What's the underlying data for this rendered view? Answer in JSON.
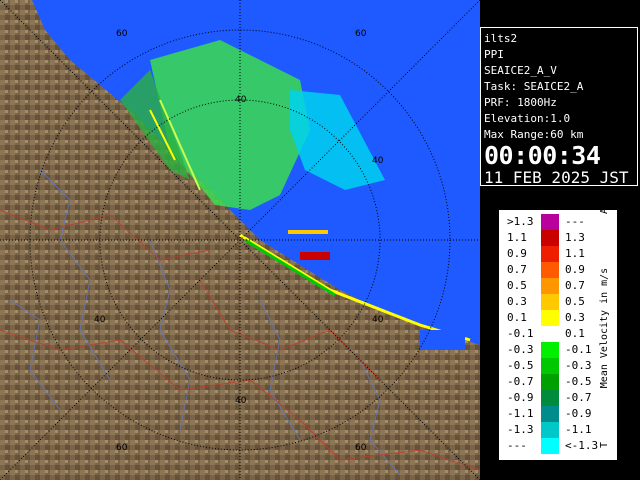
{
  "info": {
    "station": "ilts2",
    "product": "PPI",
    "scan": "SEAICE2_A_V",
    "task": "Task: SEAICE2_A",
    "prf": "PRF: 1800Hz",
    "elevation": "Elevation:1.0",
    "max_range": "Max Range:60 km",
    "time": "00:00:34",
    "date": "11 FEB 2025 JST"
  },
  "rings": {
    "labels": [
      "40",
      "40",
      "40",
      "40",
      "40",
      "60",
      "60",
      "60",
      "60"
    ]
  },
  "legend": {
    "title": "Mean Velocity in m/s",
    "top_mark": "A",
    "bottom_mark": "T",
    "rows": [
      {
        "left": ">1.3",
        "right": "---",
        "color": "#b8009c"
      },
      {
        "left": "1.1",
        "right": "1.3",
        "color": "#c80000"
      },
      {
        "left": "0.9",
        "right": "1.1",
        "color": "#f01e00"
      },
      {
        "left": "0.7",
        "right": "0.9",
        "color": "#ff5a00"
      },
      {
        "left": "0.5",
        "right": "0.7",
        "color": "#ff9600"
      },
      {
        "left": "0.3",
        "right": "0.5",
        "color": "#ffc800"
      },
      {
        "left": "0.1",
        "right": "0.3",
        "color": "#ffff00"
      },
      {
        "left": "-0.1",
        "right": "0.1",
        "color": "#ffffff"
      },
      {
        "left": "-0.3",
        "right": "-0.1",
        "color": "#00f000"
      },
      {
        "left": "-0.5",
        "right": "-0.3",
        "color": "#00c800"
      },
      {
        "left": "-0.7",
        "right": "-0.5",
        "color": "#00a000"
      },
      {
        "left": "-0.9",
        "right": "-0.7",
        "color": "#008c3c"
      },
      {
        "left": "-1.1",
        "right": "-0.9",
        "color": "#008c8c"
      },
      {
        "left": "-1.3",
        "right": "-1.1",
        "color": "#00c8c8"
      },
      {
        "left": "---",
        "right": "<-1.3",
        "color": "#00ffff"
      }
    ]
  },
  "colors": {
    "sea": "#1e5aff",
    "land": "#7a6448",
    "ring": "#000000",
    "echo_green": "#3cdc50",
    "echo_cyan": "#00f0f0"
  }
}
